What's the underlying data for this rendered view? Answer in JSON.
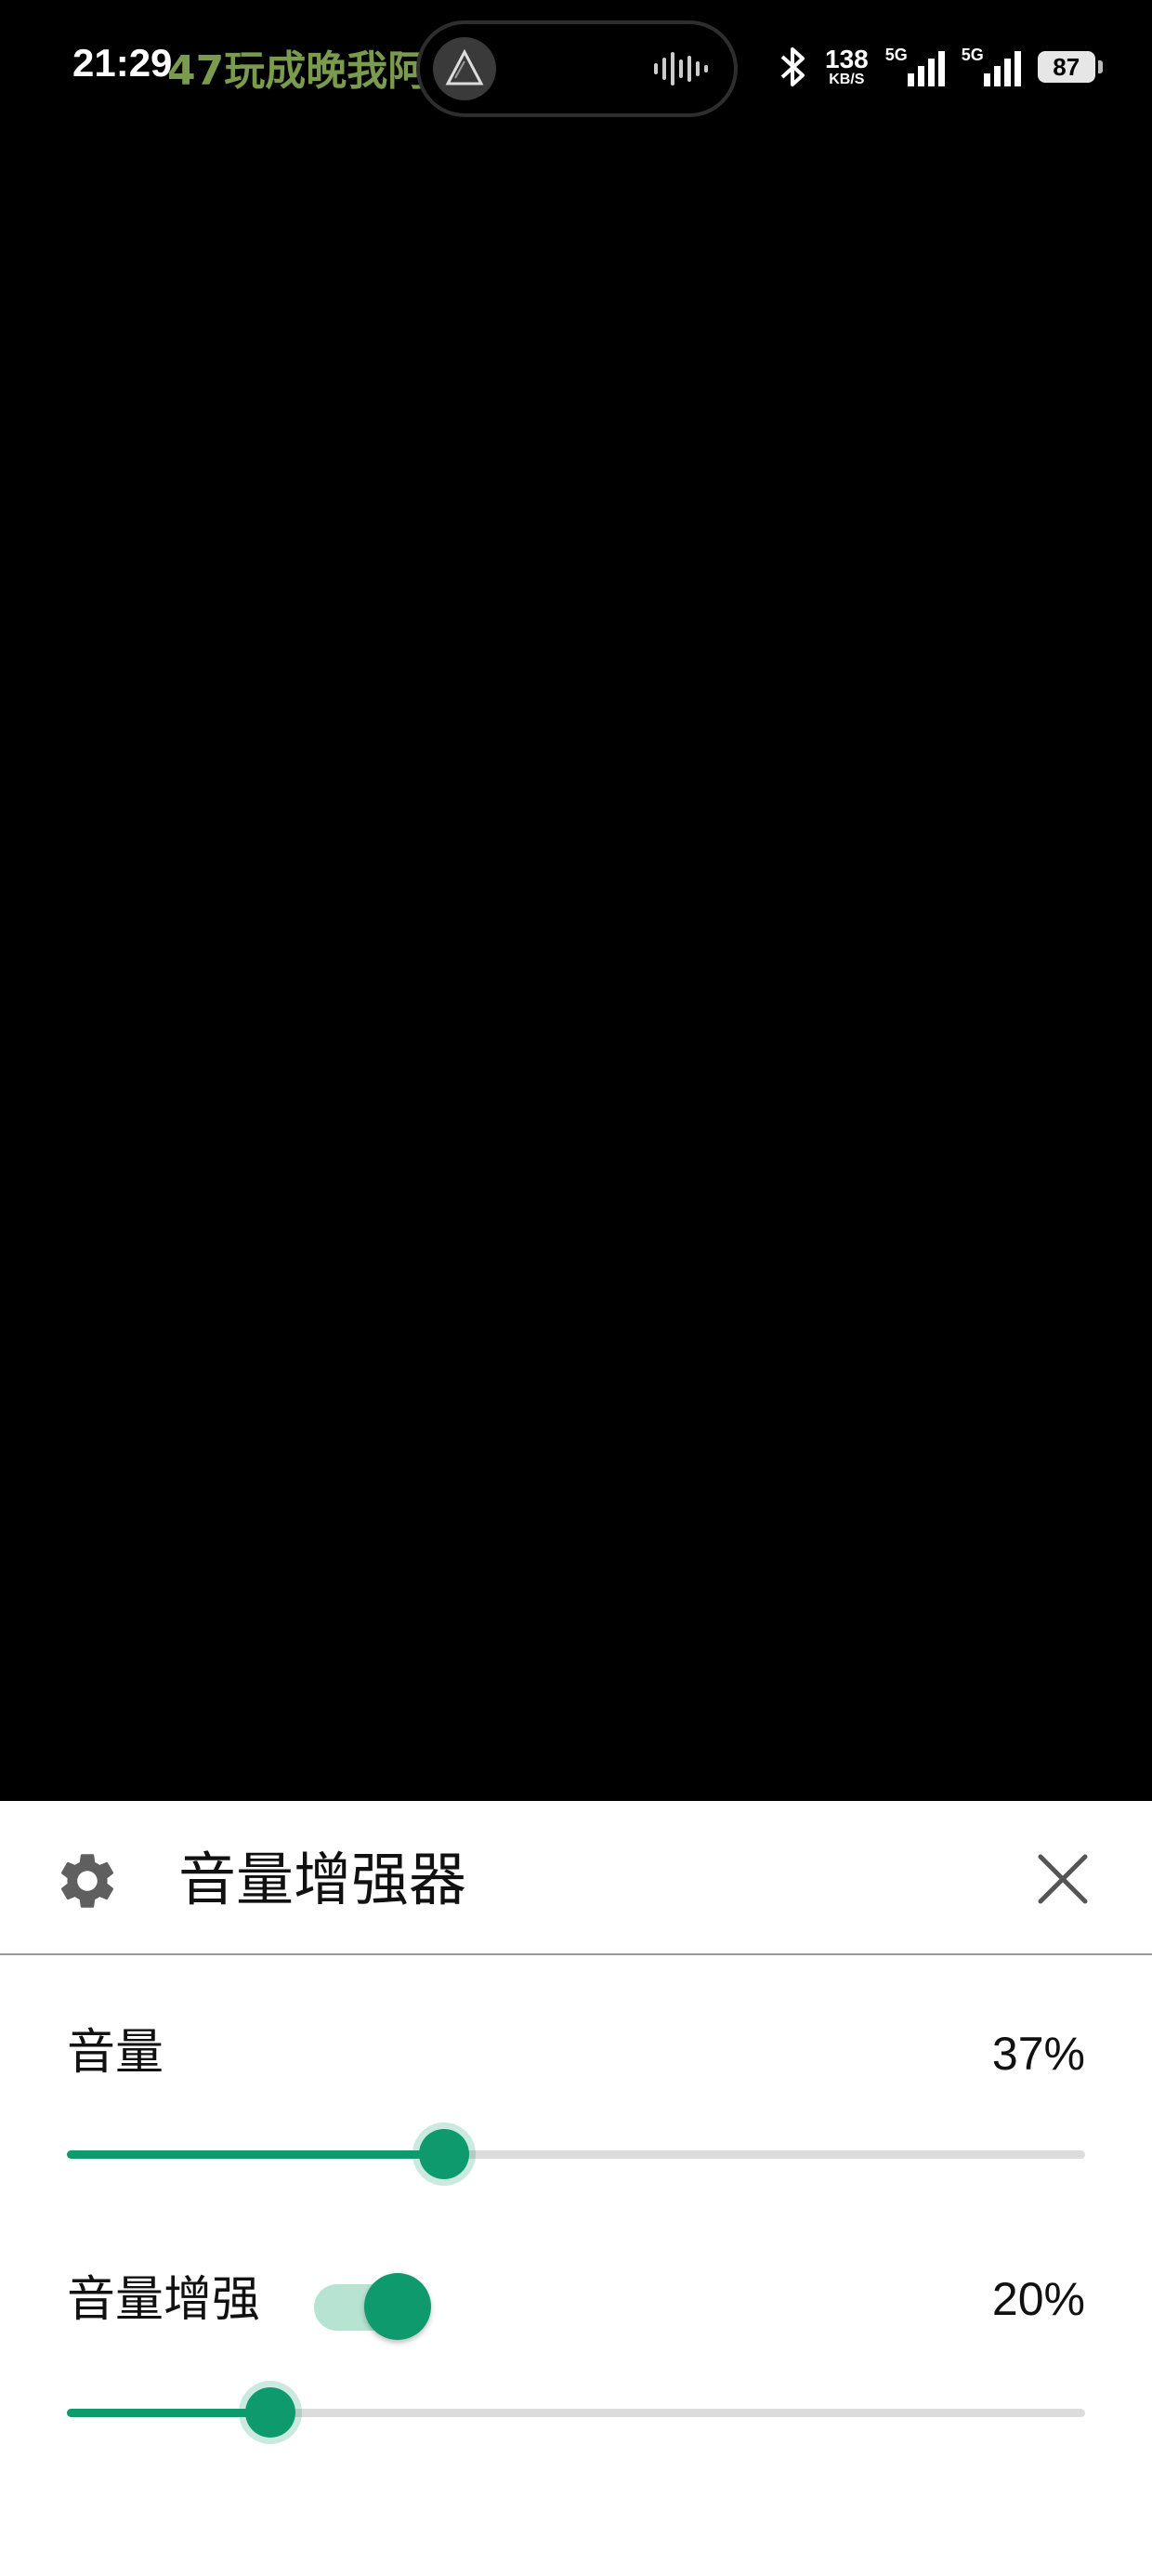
{
  "status_bar": {
    "time": "21:29",
    "marquee_text": "47玩成晚我阿",
    "net_speed_value": "138",
    "net_speed_unit": "KB/S",
    "sim1_label": "5G",
    "sim2_label": "5G",
    "battery": "87",
    "icons": [
      "bluetooth-icon",
      "signal-icon",
      "signal-icon",
      "battery-icon",
      "music-disc-icon",
      "audio-wave-icon"
    ]
  },
  "panel": {
    "title": "音量增强器",
    "icons": [
      "gear-icon",
      "close-icon"
    ],
    "accent_color": "#0f9a6e",
    "volume": {
      "label": "音量",
      "value_text": "37%",
      "level": 0.37
    },
    "boost": {
      "label": "音量增强",
      "enabled": true,
      "value_text": "20%",
      "level": 0.2
    }
  }
}
